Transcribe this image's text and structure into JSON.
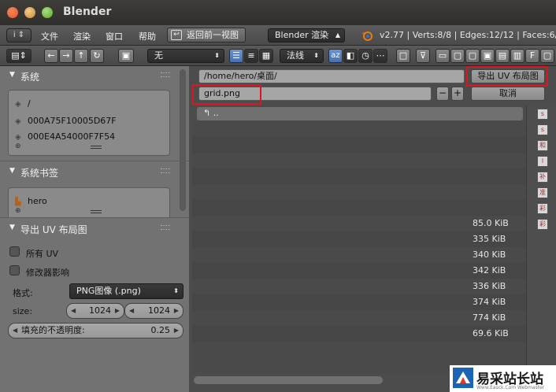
{
  "window": {
    "title": "Blender"
  },
  "info_header": {
    "editor_type_glyph": "i",
    "menus": [
      "文件",
      "渲染",
      "窗口",
      "帮助"
    ],
    "back_button": "返回前一视图",
    "renderer": "Blender 渲染",
    "stats": "v2.77 | Verts:8/8 | Edges:12/12 | Faces:6/6"
  },
  "toolbar": {
    "recursion_select": "无",
    "sort_select": "法线",
    "az_label": "az"
  },
  "sidebar": {
    "system": {
      "title": "系统",
      "items": [
        {
          "label": "/",
          "icon": "drive-icon"
        },
        {
          "label": "000A75F10005D67F",
          "icon": "drive-icon"
        },
        {
          "label": "000E4A54000F7F54",
          "icon": "drive-icon"
        }
      ]
    },
    "bookmarks": {
      "title": "系统书签",
      "items": [
        {
          "label": "hero",
          "icon": "folder-icon"
        }
      ]
    },
    "export": {
      "title": "导出 UV 布局图",
      "all_uv": "所有 UV",
      "modifier": "修改器影响",
      "format_label": "格式:",
      "format_value": "PNG图像 (.png)",
      "size_label": "size:",
      "size_w": "1024",
      "size_h": "1024",
      "opacity_label": "填充的不透明度:",
      "opacity_value": "0.25"
    }
  },
  "browser": {
    "path": "/home/hero/桌面/",
    "filename": "grid.png",
    "export_button": "导出 UV 布局图",
    "cancel_button": "取消",
    "parent": "..",
    "minus": "−",
    "plus": "+",
    "sizes": [
      "85.0 KiB",
      "335 KiB",
      "340 KiB",
      "342 KiB",
      "336 KiB",
      "374 KiB",
      "774 KiB",
      "69.6 KiB"
    ],
    "thumb_glyphs": [
      "s",
      "s",
      "和",
      "l",
      "补",
      "准",
      "彩",
      "彩"
    ]
  },
  "watermark": {
    "text": "易采站长站",
    "url": "Www.Easck.Com Webmaster"
  },
  "colors": {
    "highlight": "#e0141c",
    "panel": "#727272",
    "header": "#4a4a4a"
  }
}
